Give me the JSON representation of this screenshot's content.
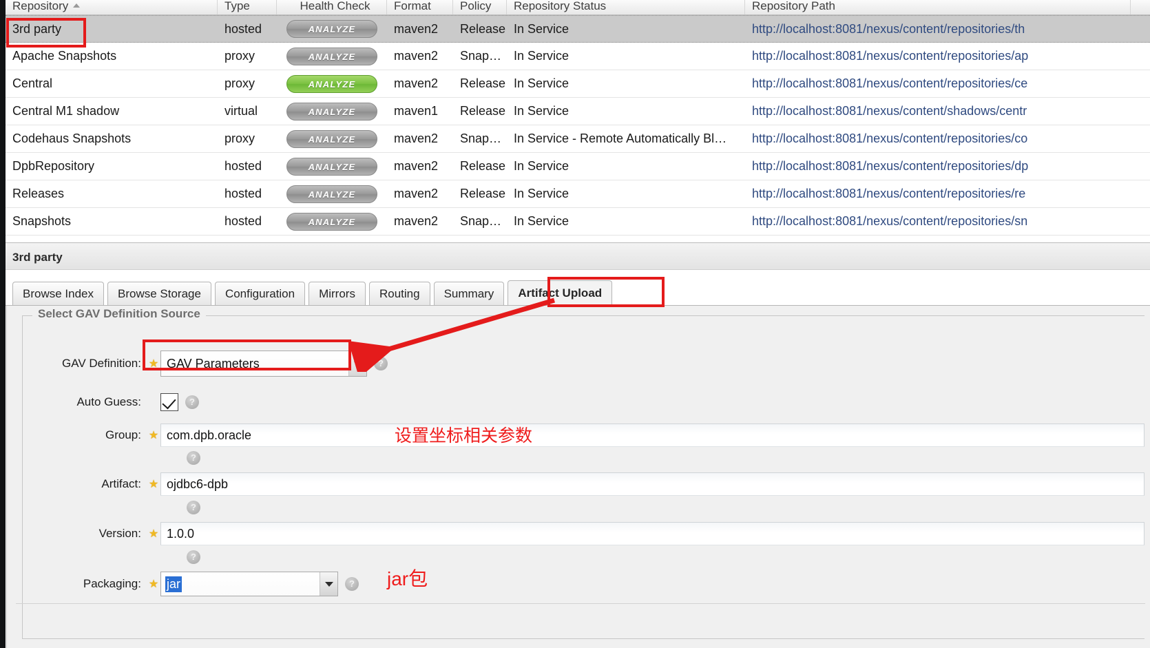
{
  "grid": {
    "columns": [
      {
        "key": "repository",
        "label": "Repository",
        "sorted": true
      },
      {
        "key": "type",
        "label": "Type"
      },
      {
        "key": "health",
        "label": "Health Check"
      },
      {
        "key": "format",
        "label": "Format"
      },
      {
        "key": "policy",
        "label": "Policy"
      },
      {
        "key": "status",
        "label": "Repository Status"
      },
      {
        "key": "path",
        "label": "Repository Path"
      }
    ],
    "analyze_label": "ANALYZE",
    "rows": [
      {
        "repository": "3rd party",
        "type": "hosted",
        "health": "ANALYZE",
        "health_state": "grey",
        "format": "maven2",
        "policy": "Release",
        "status": "In Service",
        "path": "http://localhost:8081/nexus/content/repositories/th",
        "selected": true
      },
      {
        "repository": "Apache Snapshots",
        "type": "proxy",
        "health": "ANALYZE",
        "health_state": "grey",
        "format": "maven2",
        "policy": "Snapshot",
        "status": "In Service",
        "path": "http://localhost:8081/nexus/content/repositories/ap",
        "selected": false
      },
      {
        "repository": "Central",
        "type": "proxy",
        "health": "ANALYZE",
        "health_state": "green",
        "format": "maven2",
        "policy": "Release",
        "status": "In Service",
        "path": "http://localhost:8081/nexus/content/repositories/ce",
        "selected": false
      },
      {
        "repository": "Central M1 shadow",
        "type": "virtual",
        "health": "ANALYZE",
        "health_state": "grey",
        "format": "maven1",
        "policy": "Release",
        "status": "In Service",
        "path": "http://localhost:8081/nexus/content/shadows/centr",
        "selected": false
      },
      {
        "repository": "Codehaus Snapshots",
        "type": "proxy",
        "health": "ANALYZE",
        "health_state": "grey",
        "format": "maven2",
        "policy": "Snapshot",
        "status": "In Service - Remote Automatically Bl…",
        "path": "http://localhost:8081/nexus/content/repositories/co",
        "selected": false
      },
      {
        "repository": "DpbRepository",
        "type": "hosted",
        "health": "ANALYZE",
        "health_state": "grey",
        "format": "maven2",
        "policy": "Release",
        "status": "In Service",
        "path": "http://localhost:8081/nexus/content/repositories/dp",
        "selected": false
      },
      {
        "repository": "Releases",
        "type": "hosted",
        "health": "ANALYZE",
        "health_state": "grey",
        "format": "maven2",
        "policy": "Release",
        "status": "In Service",
        "path": "http://localhost:8081/nexus/content/repositories/re",
        "selected": false
      },
      {
        "repository": "Snapshots",
        "type": "hosted",
        "health": "ANALYZE",
        "health_state": "grey",
        "format": "maven2",
        "policy": "Snapshot",
        "status": "In Service",
        "path": "http://localhost:8081/nexus/content/repositories/sn",
        "selected": false
      }
    ]
  },
  "detail": {
    "title": "3rd party",
    "tabs": [
      {
        "label": "Browse Index",
        "active": false
      },
      {
        "label": "Browse Storage",
        "active": false
      },
      {
        "label": "Configuration",
        "active": false
      },
      {
        "label": "Mirrors",
        "active": false
      },
      {
        "label": "Routing",
        "active": false
      },
      {
        "label": "Summary",
        "active": false
      },
      {
        "label": "Artifact Upload",
        "active": true
      }
    ]
  },
  "form": {
    "legend": "Select GAV Definition Source",
    "help_glyph": "?",
    "star_glyph": "★",
    "gav_definition": {
      "label": "GAV Definition:",
      "value": "GAV Parameters"
    },
    "auto_guess": {
      "label": "Auto Guess:",
      "checked": true
    },
    "group": {
      "label": "Group:",
      "value": "com.dpb.oracle"
    },
    "artifact": {
      "label": "Artifact:",
      "value": "ojdbc6-dpb"
    },
    "version": {
      "label": "Version:",
      "value": "1.0.0"
    },
    "packaging": {
      "label": "Packaging:",
      "value": "jar"
    }
  },
  "annotations": {
    "gav_note": "设置坐标相关参数",
    "packaging_note": "jar包",
    "highlight_color": "#e41b1b"
  }
}
